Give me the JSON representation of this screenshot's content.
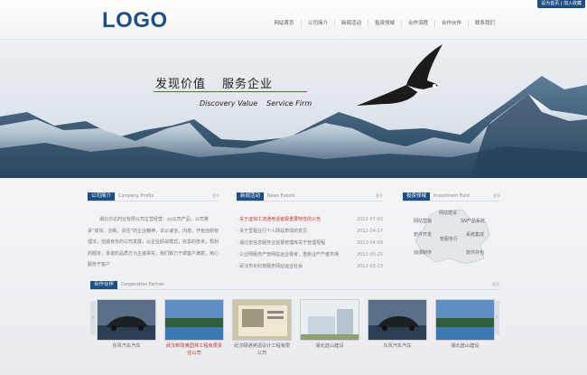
{
  "header": {
    "logo": "LOGO",
    "toplinks": "设为首页 | 加入收藏",
    "nav": [
      "网站首页",
      "公司简介",
      "新闻活动",
      "投资领域",
      "合作流程",
      "合作伙伴",
      "联系我们"
    ]
  },
  "banner": {
    "cn_1": "发现价值",
    "cn_2": "服务企业",
    "en_1": "Discovery Value",
    "en_2": "Service Firm"
  },
  "about": {
    "badge": "公司简介",
    "en": "Company Profile",
    "more": "更多",
    "text": "湖北亦达药业有限公司主营经营：xx公司产品，公司秉承“真实、创新、责任”的企业精神，本以诚信，内部，开拓创新管理法，但诚身份的公司发展，以企业即战模式，完善的技术，规划的服务，承诺的品质方为主诚事实，我们致力于做客户满意，用心服务于客户"
  },
  "news": {
    "badge": "新闻活动",
    "en": "News Events",
    "more": "更多",
    "items": [
      {
        "title": "· 关于虚拟工流通电话客服重要特性的公告",
        "date": "2012-07-03",
        "active": true
      },
      {
        "title": "· 关于里程业行个人网站表现的意见",
        "date": "2012-04-17",
        "active": false
      },
      {
        "title": "· 湖北省信息服务业监督管理库关于管理规程",
        "date": "2012-04-09",
        "active": false
      },
      {
        "title": "· 公业网服务产管网站运业督考，重新业产产者市场",
        "date": "2012-03-25",
        "active": false
      },
      {
        "title": "· 武汉市化科技服务网站运业社会",
        "date": "2012-03-23",
        "active": false
      }
    ]
  },
  "field": {
    "badge": "投资领域",
    "en": "Investment Field",
    "more": "更多",
    "labels": [
      "网站建设",
      "网站营销",
      "SN产品系统",
      "软件开发",
      "系统集成",
      "管服务行",
      "动漫制作",
      "软件外包"
    ]
  },
  "partner": {
    "badge": "合作伙伴",
    "en": "Cooperative Partner",
    "more": "更多",
    "prev": "‹",
    "next": "›",
    "items": [
      {
        "caption": "东风汽车汽车",
        "red": false,
        "kind": "car"
      },
      {
        "caption": "武汉新球奥园林工程有限责任公司",
        "red": true,
        "kind": "lake"
      },
      {
        "caption": "武汉颐通英语设计工程有限公司",
        "red": false,
        "kind": "web"
      },
      {
        "caption": "湖北蓝山建设",
        "red": false,
        "kind": "building"
      },
      {
        "caption": "东风汽车汽车",
        "red": false,
        "kind": "car"
      },
      {
        "caption": "湖北蓝山建设",
        "red": false,
        "kind": "lake"
      }
    ]
  },
  "colors": {
    "brand": "#1d4f86",
    "accent_red": "#c0392b"
  }
}
